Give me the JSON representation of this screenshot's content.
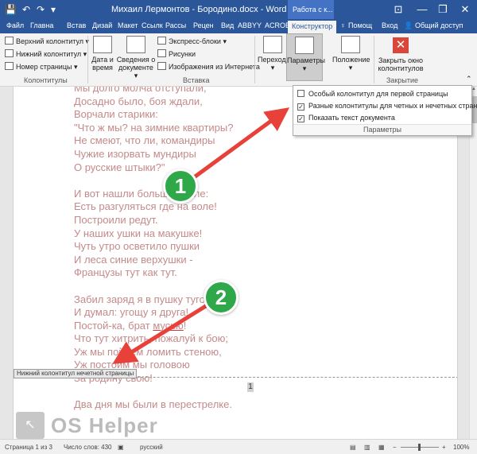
{
  "window": {
    "title": "Михаил Лермонтов - Бородино.docx - Word",
    "context_tab": "Работа с к...",
    "controls": [
      "—",
      "❐",
      "✕"
    ]
  },
  "quick_access": [
    "💾",
    "↶",
    "↷",
    "▾"
  ],
  "ribbon_display_icon": "⊡",
  "tabs": [
    "Файл",
    "Главна",
    "Встав",
    "Дизай",
    "Макет",
    "Ссылк",
    "Рассы",
    "Рецен",
    "Вид",
    "ABBYY",
    "ACROB",
    "Конструктор"
  ],
  "tabs_right": {
    "help": "Помощ",
    "signin": "Вход",
    "share": "Общий доступ"
  },
  "ribbon": {
    "headers_footers": {
      "items": [
        "Верхний колонтитул ▾",
        "Нижний колонтитул ▾",
        "Номер страницы ▾"
      ],
      "label": "Колонтитулы"
    },
    "insert": {
      "date_time": "Дата и время",
      "doc_info": "Сведения о документе ▾",
      "express_blocks": "Экспресс-блоки ▾",
      "pictures": "Рисунки",
      "online_pictures": "Изображения из Интернета",
      "label": "Вставка"
    },
    "navigation": {
      "label": "Переходы",
      "arrow": "▾"
    },
    "parameters": {
      "label": "Параметры",
      "arrow": "▾"
    },
    "position": {
      "label": "Положение",
      "arrow": "▾"
    },
    "close": {
      "label": "Закрыть окно колонтитулов",
      "group": "Закрытие"
    }
  },
  "dropdown": {
    "items": [
      {
        "label": "Особый колонтитул для первой страницы",
        "checked": false
      },
      {
        "label": "Разные колонтитулы для четных и нечетных страниц",
        "checked": true
      },
      {
        "label": "Показать текст документа",
        "checked": true
      }
    ],
    "footer": "Параметры",
    "check_mark": "✓"
  },
  "poem": [
    "Мы долго молча отступали,",
    "Досадно было, боя ждали,",
    "Ворчали старики:",
    "\"Что ж мы? на зимние квартиры?",
    "Не смеют, что ли, командиры",
    "Чужие изорвать мундиры",
    "О русские штыки?\"",
    "",
    "И вот нашли большое поле:",
    "Есть разгуляться где на воле!",
    "Построили редут.",
    "У наших ушки на макушке!",
    "Чуть утро осветило пушки",
    "И леса синие верхушки -",
    "Французы тут как тут.",
    "",
    "Забил заряд я в пушку туго",
    "И думал: угощу я друга!",
    "Постой-ка, брат мусью!",
    "Что тут хитрить, пожалуй к бою;",
    "Уж мы пойдем ломить стеною,",
    "Уж постоим мы головою",
    "За родину свою!",
    "",
    "Два дня мы были в перестрелке."
  ],
  "footer_tag": "Нижний колонтитул нечетной страницы",
  "page_number": "1",
  "watermark": {
    "text": "OS Helper",
    "icon": "↖"
  },
  "status": {
    "page": "Страница 1 из 3",
    "words": "Число слов: 430",
    "lang": "русский",
    "zoom": "100%",
    "zoom_minus": "−",
    "zoom_plus": "+"
  },
  "annotations": [
    "1",
    "2"
  ],
  "colors": {
    "accent": "#2b579a",
    "badge": "#2fa84a",
    "arrow": "#e8413a",
    "poem_text": "#c48a8a"
  }
}
